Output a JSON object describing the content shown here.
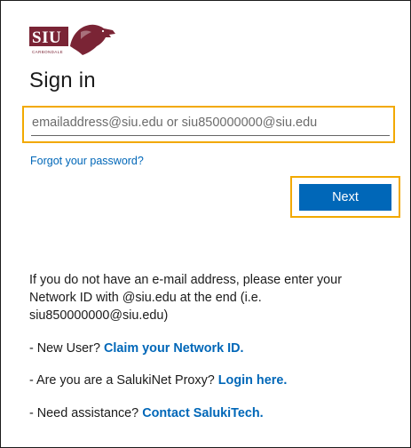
{
  "logo": {
    "text": "SIU",
    "subtext": "CARBONDALE",
    "brand_color": "#7a2435"
  },
  "header": {
    "title": "Sign in"
  },
  "email": {
    "placeholder": "emailaddress@siu.edu or siu850000000@siu.edu",
    "value": ""
  },
  "links": {
    "forgot_password": "Forgot your password?"
  },
  "buttons": {
    "next_label": "Next"
  },
  "info": {
    "paragraph": "If you do not have an e-mail address, please enter your Network ID with @siu.edu at the end (i.e. siu850000000@siu.edu)",
    "new_user_prefix": "- New User? ",
    "new_user_link": "Claim your Network ID.",
    "proxy_prefix": "- Are you are a SalukiNet Proxy? ",
    "proxy_link": "Login here.",
    "assist_prefix": "- Need assistance? ",
    "assist_link": "Contact SalukiTech."
  },
  "colors": {
    "accent": "#0067b8",
    "highlight_border": "#f2a900",
    "text": "#1b1b1b"
  }
}
